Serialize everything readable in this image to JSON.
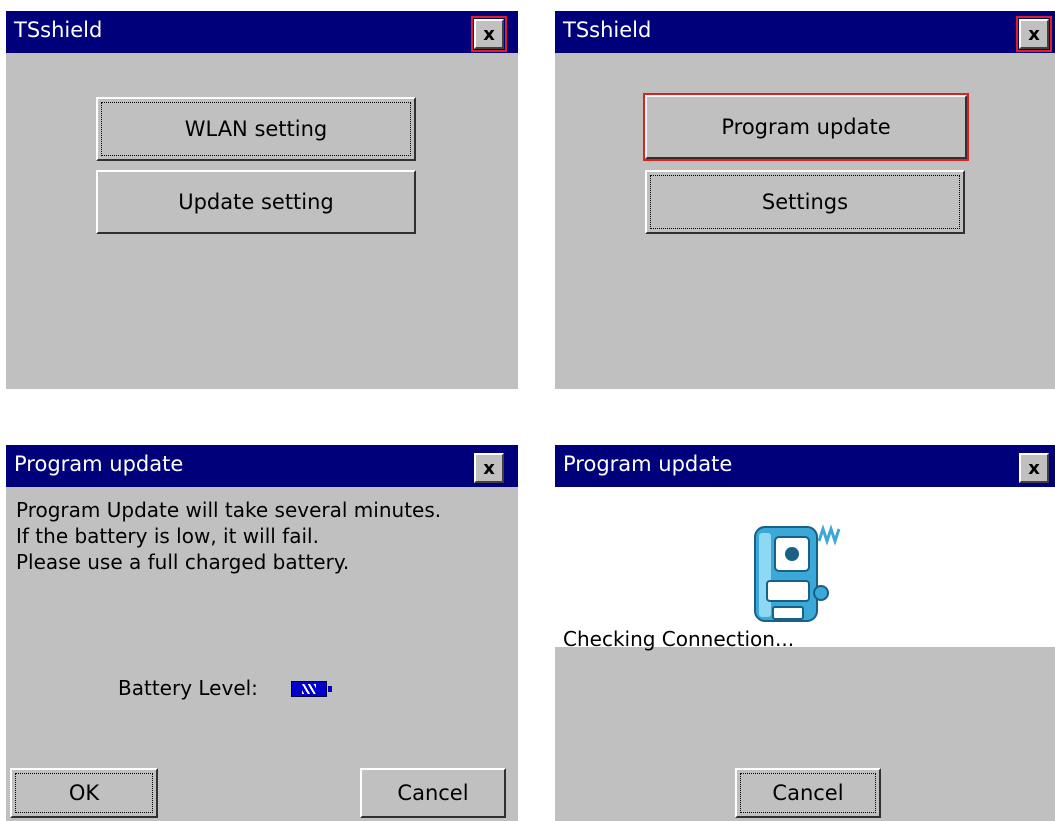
{
  "panel1": {
    "title": "TSshield",
    "close_label": "x",
    "buttons": [
      "WLAN setting",
      "Update setting"
    ]
  },
  "panel2": {
    "title": "TSshield",
    "close_label": "x",
    "buttons": [
      "Program update",
      "Settings"
    ]
  },
  "panel3": {
    "title": "Program update",
    "close_label": "x",
    "message": [
      "Program Update will take several minutes.",
      "If the battery is low, it will fail.",
      "Please use a full charged battery."
    ],
    "battery_label": "Battery Level:",
    "ok_label": "OK",
    "cancel_label": "Cancel"
  },
  "panel4": {
    "title": "Program update",
    "close_label": "x",
    "icon": "surveying-instrument-icon",
    "status": "Checking Connection...",
    "cancel_label": "Cancel"
  },
  "colors": {
    "titlebar": "#00007b",
    "window": "#c0c0c0",
    "highlight": "#e02020",
    "battery": "#0000c8"
  }
}
